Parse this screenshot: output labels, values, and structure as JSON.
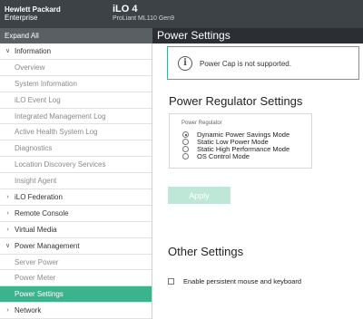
{
  "header": {
    "brand_line1": "Hewlett Packard",
    "brand_line2": "Enterprise",
    "product_name": "iLO 4",
    "product_model": "ProLiant ML110 Gen9"
  },
  "sidebar": {
    "expand_label": "Expand All",
    "items": [
      {
        "label": "Information",
        "type": "top",
        "chevron": "down"
      },
      {
        "label": "Overview",
        "type": "sub"
      },
      {
        "label": "System Information",
        "type": "sub"
      },
      {
        "label": "iLO Event Log",
        "type": "sub"
      },
      {
        "label": "Integrated Management Log",
        "type": "sub"
      },
      {
        "label": "Active Health System Log",
        "type": "sub"
      },
      {
        "label": "Diagnostics",
        "type": "sub"
      },
      {
        "label": "Location Discovery Services",
        "type": "sub"
      },
      {
        "label": "Insight Agent",
        "type": "sub"
      },
      {
        "label": "iLO Federation",
        "type": "top",
        "chevron": "right"
      },
      {
        "label": "Remote Console",
        "type": "top",
        "chevron": "right"
      },
      {
        "label": "Virtual Media",
        "type": "top",
        "chevron": "right"
      },
      {
        "label": "Power Management",
        "type": "top",
        "chevron": "down"
      },
      {
        "label": "Server Power",
        "type": "sub"
      },
      {
        "label": "Power Meter",
        "type": "sub"
      },
      {
        "label": "Power Settings",
        "type": "sub",
        "active": true
      },
      {
        "label": "Network",
        "type": "top",
        "chevron": "right"
      }
    ]
  },
  "main": {
    "page_title": "Power Settings",
    "notice_text": "Power Cap is not supported.",
    "regulator_heading": "Power Regulator Settings",
    "regulator_legend": "Power Regulator",
    "options": [
      {
        "label": "Dynamic Power Savings Mode",
        "selected": true
      },
      {
        "label": "Static Low Power Mode",
        "selected": false
      },
      {
        "label": "Static High Performance Mode",
        "selected": false
      },
      {
        "label": "OS Control Mode",
        "selected": false
      }
    ],
    "apply_label": "Apply",
    "other_heading": "Other Settings",
    "persistent_label": "Enable persistent mouse and keyboard",
    "persistent_checked": false
  },
  "colors": {
    "header_bg": "#3d4247",
    "accent": "#3bb38d",
    "apply_disabled": "#bde8d8"
  }
}
